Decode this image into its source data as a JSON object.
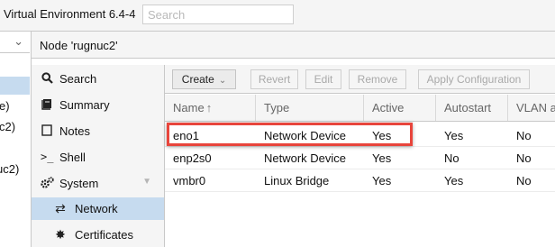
{
  "header": {
    "app_title": "Virtual Environment 6.4-4",
    "search_placeholder": "Search"
  },
  "tree": {
    "fragments": [
      "e)",
      "c2)",
      "uc2)"
    ],
    "chevron": "chevron-down-icon"
  },
  "panel": {
    "title": "Node 'rugnuc2'"
  },
  "menu": {
    "items": [
      {
        "label": "Search",
        "icon": "search-icon"
      },
      {
        "label": "Summary",
        "icon": "book-icon"
      },
      {
        "label": "Notes",
        "icon": "notes-icon"
      },
      {
        "label": "Shell",
        "icon": "terminal-icon"
      },
      {
        "label": "System",
        "icon": "gears-icon"
      },
      {
        "label": "Network",
        "icon": "exchange-icon",
        "selected": true
      },
      {
        "label": "Certificates",
        "icon": "certificate-icon"
      }
    ]
  },
  "toolbar": {
    "create": "Create",
    "revert": "Revert",
    "edit": "Edit",
    "remove": "Remove",
    "apply": "Apply Configuration"
  },
  "grid": {
    "columns": [
      "Name",
      "Type",
      "Active",
      "Autostart",
      "VLAN a"
    ],
    "sort": "ascending",
    "rows": [
      [
        "eno1",
        "Network Device",
        "Yes",
        "Yes",
        "No"
      ],
      [
        "enp2s0",
        "Network Device",
        "Yes",
        "No",
        "No"
      ],
      [
        "vmbr0",
        "Linux Bridge",
        "Yes",
        "Yes",
        "No"
      ]
    ]
  },
  "colors": {
    "selection": "#c6dbef",
    "highlight": "#e8453c",
    "panel_bg": "#f5f5f5"
  }
}
